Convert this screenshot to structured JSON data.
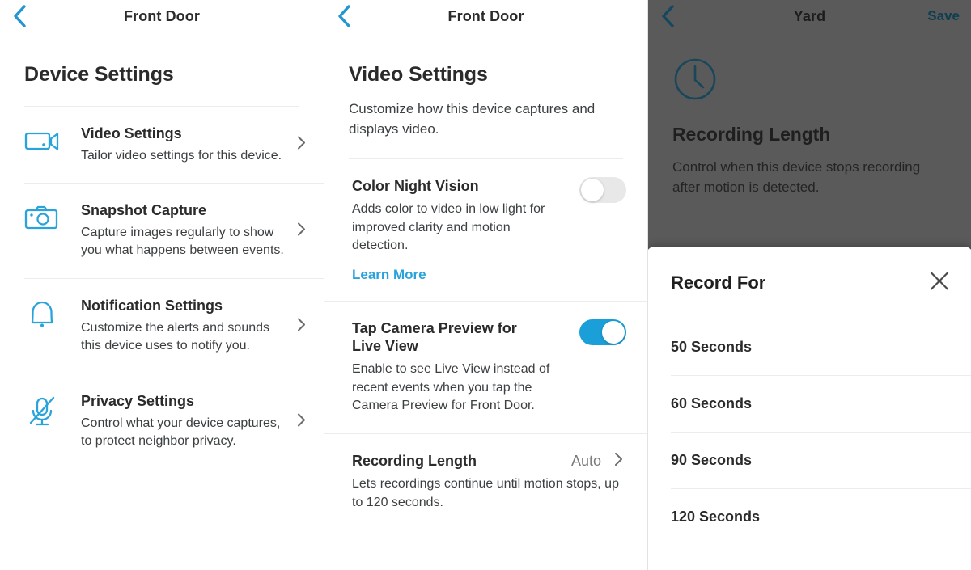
{
  "accent": {
    "blue": "#1b9fd8",
    "link_blue": "#2aa3db",
    "icon_blue": "#2aa3db",
    "toggle_on": "#1b9fd8",
    "toggle_off": "#e8e8e8",
    "overlay": "#5a5a5a",
    "text_dark": "#2b2b2b",
    "text_body": "#3c4043",
    "text_muted": "#7b7b7b"
  },
  "panel_device_settings": {
    "nav": {
      "title": "Front Door",
      "back_icon": "chevron-left-icon"
    },
    "page_title": "Device Settings",
    "items": [
      {
        "icon": "video-camera-icon",
        "title": "Video Settings",
        "desc": "Tailor video settings for this device.",
        "chevron": "chevron-right-icon"
      },
      {
        "icon": "camera-icon",
        "title": "Snapshot Capture",
        "desc": "Capture images regularly to show you what happens between events.",
        "chevron": "chevron-right-icon"
      },
      {
        "icon": "bell-icon",
        "title": "Notification Settings",
        "desc": "Customize the alerts and sounds this device uses to notify you.",
        "chevron": "chevron-right-icon"
      },
      {
        "icon": "microphone-off-icon",
        "title": "Privacy Settings",
        "desc": "Control what your device captures, to protect neighbor privacy.",
        "chevron": "chevron-right-icon"
      }
    ]
  },
  "panel_video_settings": {
    "nav": {
      "title": "Front Door",
      "back_icon": "chevron-left-icon"
    },
    "page_title": "Video Settings",
    "page_sub": "Customize how this device captures and displays video.",
    "rows": [
      {
        "title": "Color Night Vision",
        "desc": "Adds color to video in low light for improved clarity and motion detection.",
        "link": "Learn More",
        "toggle": "off"
      },
      {
        "title": "Tap Camera Preview for Live View",
        "desc": "Enable to see Live View instead of recent events when you tap the Camera Preview for Front Door.",
        "toggle": "on"
      },
      {
        "title": "Recording Length",
        "value": "Auto",
        "desc": "Lets recordings continue until motion stops, up to 120 seconds.",
        "chevron": "chevron-right-icon"
      }
    ]
  },
  "panel_recording_length": {
    "nav": {
      "title": "Yard",
      "back_icon": "chevron-left-icon",
      "save_label": "Save"
    },
    "icon": "clock-icon",
    "title": "Recording Length",
    "desc": "Control when this device stops recording after motion is detected.",
    "sheet": {
      "title": "Record For",
      "close_icon": "close-icon",
      "options": [
        "50 Seconds",
        "60 Seconds",
        "90 Seconds",
        "120 Seconds"
      ]
    }
  }
}
